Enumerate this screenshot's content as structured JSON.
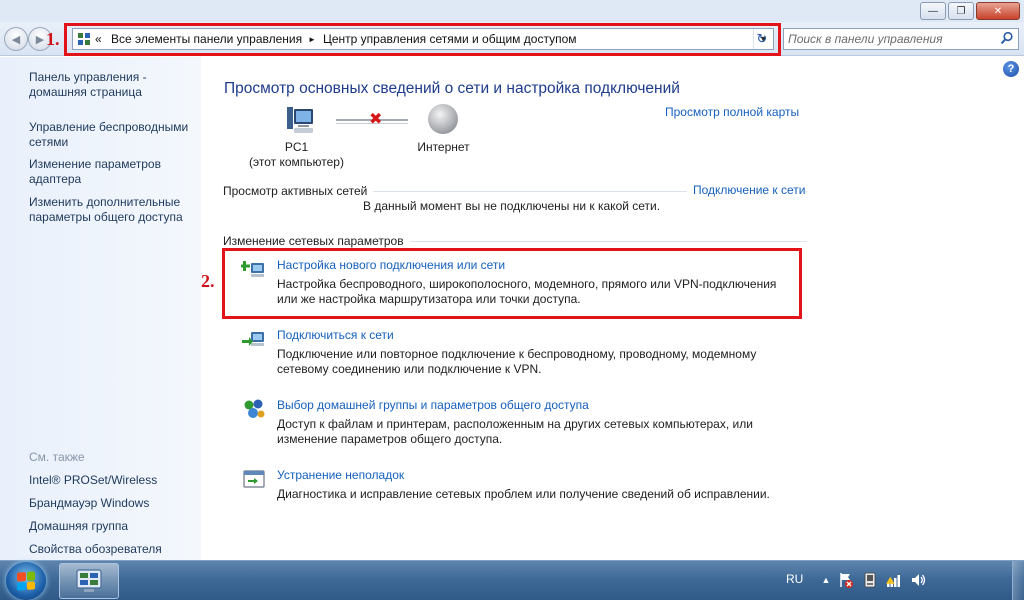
{
  "window": {
    "minimize_glyph": "—",
    "maximize_glyph": "❐",
    "close_glyph": "✕"
  },
  "navbar": {
    "back_glyph": "◀",
    "forward_glyph": "▶",
    "address": {
      "overflow": "«",
      "crumbs": [
        "Все элементы панели управления",
        "Центр управления сетями и общим доступом"
      ],
      "separator": "►",
      "dropdown_glyph": "▼"
    },
    "refresh_glyph": "↻",
    "search": {
      "placeholder": "Поиск в панели управления"
    }
  },
  "annotations": {
    "label_1": "1.",
    "label_2": "2.",
    "color": "#e2141a"
  },
  "sidebar": {
    "links": [
      "Панель управления - домашняя страница",
      "Управление беспроводными сетями",
      "Изменение параметров адаптера",
      "Изменить дополнительные параметры общего доступа"
    ],
    "see_also_title": "См. также",
    "see_also": [
      "Intel® PROSet/Wireless",
      "Брандмауэр Windows",
      "Домашняя группа",
      "Свойства обозревателя"
    ]
  },
  "main": {
    "help_glyph": "?",
    "title": "Просмотр основных сведений о сети и настройка подключений",
    "full_map_link": "Просмотр полной карты",
    "network_map": {
      "pc_name": "PC1",
      "pc_sub": "(этот компьютер)",
      "disconnected_glyph": "✖",
      "internet": "Интернет"
    },
    "active_networks": {
      "header": "Просмотр активных сетей",
      "connect_link": "Подключение к сети",
      "status": "В данный момент вы не подключены ни к какой сети."
    },
    "change_settings": {
      "header": "Изменение сетевых параметров",
      "tasks": [
        {
          "icon": "new-connection-icon",
          "link": "Настройка нового подключения или сети",
          "desc": "Настройка беспроводного, широкополосного, модемного, прямого или VPN-подключения или же настройка маршрутизатора или точки доступа."
        },
        {
          "icon": "connect-network-icon",
          "link": "Подключиться к сети",
          "desc": "Подключение или повторное подключение к беспроводному, проводному, модемному сетевому соединению или подключение к VPN."
        },
        {
          "icon": "homegroup-icon",
          "link": "Выбор домашней группы и параметров общего доступа",
          "desc": "Доступ к файлам и принтерам, расположенным на других сетевых компьютерах, или изменение параметров общего доступа."
        },
        {
          "icon": "troubleshoot-icon",
          "link": "Устранение неполадок",
          "desc": "Диагностика и исправление сетевых проблем или получение сведений об исправлении."
        }
      ]
    }
  },
  "taskbar": {
    "language": "RU",
    "tray_icons": [
      "tray-arrow-icon",
      "action-center-icon",
      "device-icon",
      "network-icon",
      "volume-icon"
    ]
  }
}
